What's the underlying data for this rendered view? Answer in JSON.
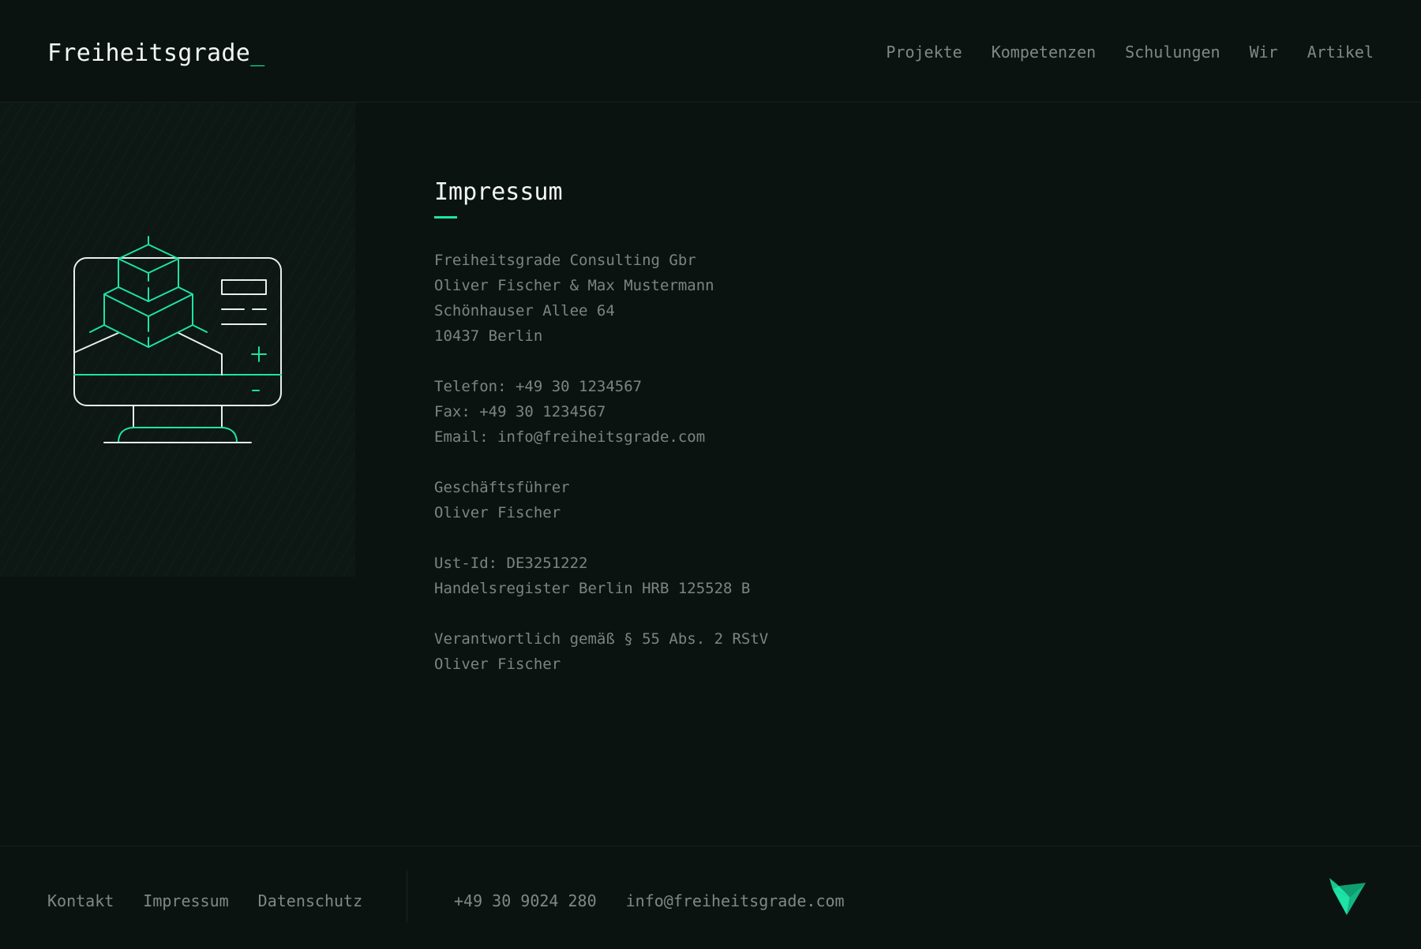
{
  "header": {
    "logo_text": "Freiheitsgrade",
    "logo_cursor": "_",
    "nav": [
      {
        "label": "Projekte"
      },
      {
        "label": "Kompetenzen"
      },
      {
        "label": "Schulungen"
      },
      {
        "label": "Wir"
      },
      {
        "label": "Artikel"
      }
    ]
  },
  "main": {
    "title": "Impressum",
    "address": {
      "company": "Freiheitsgrade Consulting Gbr",
      "owners": "Oliver Fischer & Max Mustermann",
      "street": "Schönhauser Allee 64",
      "city": "10437 Berlin"
    },
    "contact": {
      "phone": "Telefon: +49 30 1234567",
      "fax": "Fax: +49 30 1234567",
      "email": "Email: info@freiheitsgrade.com"
    },
    "management": {
      "label": "Geschäftsführer",
      "name": "Oliver Fischer"
    },
    "registration": {
      "vat": "Ust-Id: DE3251222",
      "register": "Handelsregister Berlin HRB 125528 B"
    },
    "responsible": {
      "label": "Verantwortlich gemäß § 55 Abs. 2 RStV",
      "name": "Oliver Fischer"
    },
    "illustration_icon": "computer-with-isometric-cubes-icon"
  },
  "footer": {
    "links": [
      {
        "label": "Kontakt"
      },
      {
        "label": "Impressum"
      },
      {
        "label": "Datenschutz"
      }
    ],
    "phone": "+49 30 9024 280",
    "email": "info@freiheitsgrade.com",
    "logo_icon": "origami-bird-icon"
  },
  "colors": {
    "background": "#0b1311",
    "accent": "#1de3a5",
    "text_primary": "#f2f6f4",
    "text_muted": "#7a8581"
  }
}
